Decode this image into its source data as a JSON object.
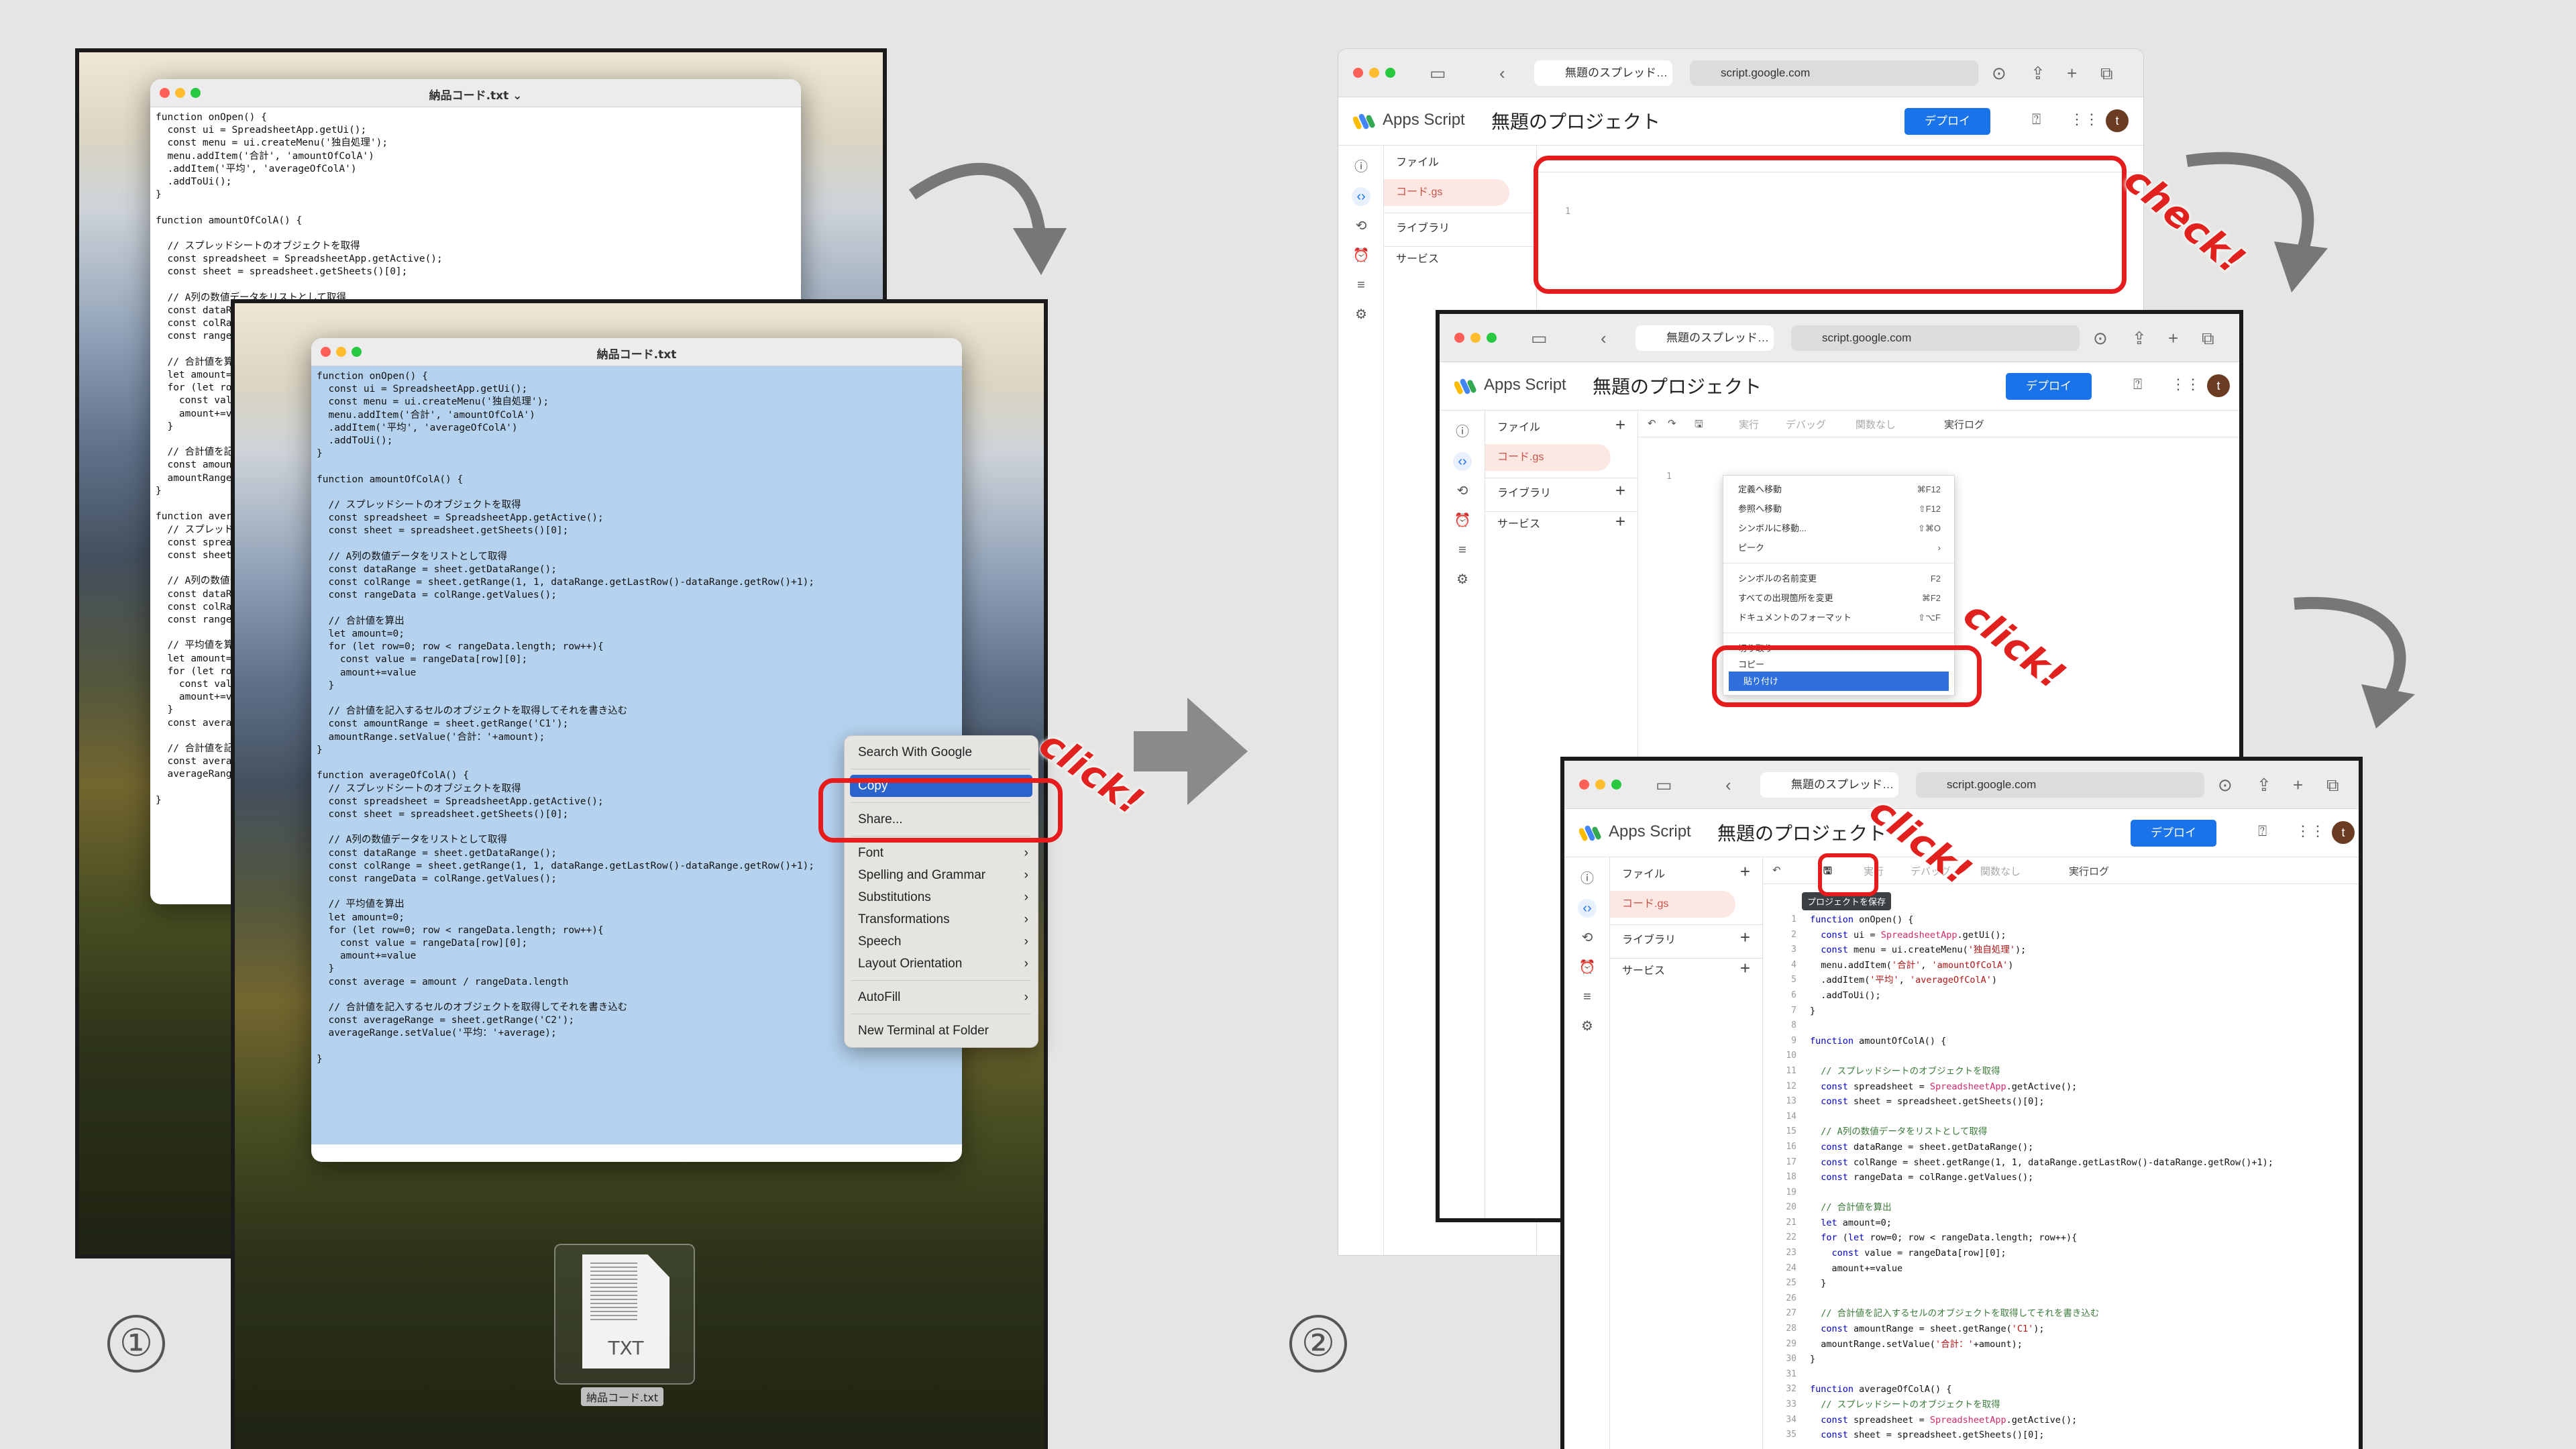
{
  "step_labels": [
    "①",
    "②"
  ],
  "annotations": {
    "click": "click!",
    "check": "check!"
  },
  "editor_file": {
    "title": "納品コード.txt",
    "title_menu": "納品コード.txt ⌄"
  },
  "code_listing": [
    "function onOpen() {",
    "  const ui = SpreadsheetApp.getUi();",
    "  const menu = ui.createMenu('独自処理');",
    "  menu.addItem('合計', 'amountOfColA')",
    "  .addItem('平均', 'averageOfColA')",
    "  .addToUi();",
    "}",
    "",
    "function amountOfColA() {",
    "",
    "  // スプレッドシートのオブジェクトを取得",
    "  const spreadsheet = SpreadsheetApp.getActive();",
    "  const sheet = spreadsheet.getSheets()[0];",
    "",
    "  // A列の数値データをリストとして取得",
    "  const dataRange = sheet.getDataRange();",
    "  const colRange = sheet.getRange(1, 1, dataRange.getLastRow()-dataRange.getRow()+1);",
    "  const rangeData = colRange.getValues();",
    "",
    "  // 合計値を算出",
    "  let amount=0;",
    "  for (let row=0; row < rangeData.length; row++){",
    "    const value = rangeData[row][0];",
    "    amount+=value",
    "  }",
    "",
    "  // 合計値を記入するセルのオブジェクトを取得してそれを書き込む",
    "  const amountRange = sheet.getRange('C1');",
    "  amountRange.setValue('合計：'+amount);",
    "}",
    "",
    "function averageOfColA() {",
    "  // スプレッドシートのオブジェクトを取得",
    "  const spreadsheet = SpreadsheetApp.getActive();",
    "  const sheet = spreadsheet.getSheets()[0];",
    "",
    "  // A列の数値データをリストとして取得",
    "  const dataRange = sheet.getDataRange();",
    "  const colRange = sheet.getRange(1, 1, dataRange.getLastRow()-dataRange.getRow()+1);",
    "  const rangeData = colRange.getValues();",
    "",
    "  // 平均値を算出",
    "  let amount=0;",
    "  for (let row=0; row < rangeData.length; row++){",
    "    const value = rangeData[row][0];",
    "    amount+=value",
    "  }",
    "  const average = amount / rangeData.length",
    "",
    "  // 合計値を記入するセルのオブジェクトを取得してそれを書き込む",
    "  const averageRange = sheet.getRange('C2');",
    "  averageRange.setValue('平均：'+average);",
    "",
    "}"
  ],
  "context_menu": {
    "items": [
      "Search With Google",
      "Copy",
      "Share...",
      "Font",
      "Spelling and Grammar",
      "Substitutions",
      "Transformations",
      "Speech",
      "Layout Orientation",
      "AutoFill",
      "New Terminal at Folder"
    ],
    "highlighted": "Copy"
  },
  "dock_file": {
    "type_label": "TXT",
    "name": "納品コード.txt"
  },
  "browser": {
    "tab_label": "無題のスプレッド…",
    "address": "script.google.com",
    "app_name": "Apps Script",
    "project_title": "無題のプロジェクト",
    "deploy_label": "デプロイ",
    "avatar_letter": "t",
    "files_label": "ファイル",
    "file_gs": "コード.gs",
    "library_label": "ライブラリ",
    "services_label": "サービス",
    "toolbar": {
      "run": "実行",
      "debug": "デバッグ",
      "no_func": "関数なし",
      "exec_log": "実行ログ"
    },
    "save_tooltip": "プロジェクトを保存",
    "line_one": "1"
  },
  "editor_menu": {
    "items": [
      {
        "label": "定義へ移動",
        "shortcut": "⌘F12"
      },
      {
        "label": "参照へ移動",
        "shortcut": "⇧F12"
      },
      {
        "label": "シンボルに移動...",
        "shortcut": "⇧⌘O"
      },
      {
        "label": "ピーク",
        "shortcut": "›"
      },
      {
        "label": "シンボルの名前変更",
        "shortcut": "F2"
      },
      {
        "label": "すべての出現箇所を変更",
        "shortcut": "⌘F2"
      },
      {
        "label": "ドキュメントのフォーマット",
        "shortcut": "⇧⌥F"
      },
      {
        "label": "切り取り",
        "shortcut": ""
      },
      {
        "label": "コピー",
        "shortcut": ""
      },
      {
        "label": "貼り付け",
        "shortcut": ""
      }
    ],
    "highlighted": "貼り付け"
  },
  "colors": {
    "accent": "#1a73e8",
    "annotation": "#e61b1b",
    "selection": "#b5d3ef"
  }
}
